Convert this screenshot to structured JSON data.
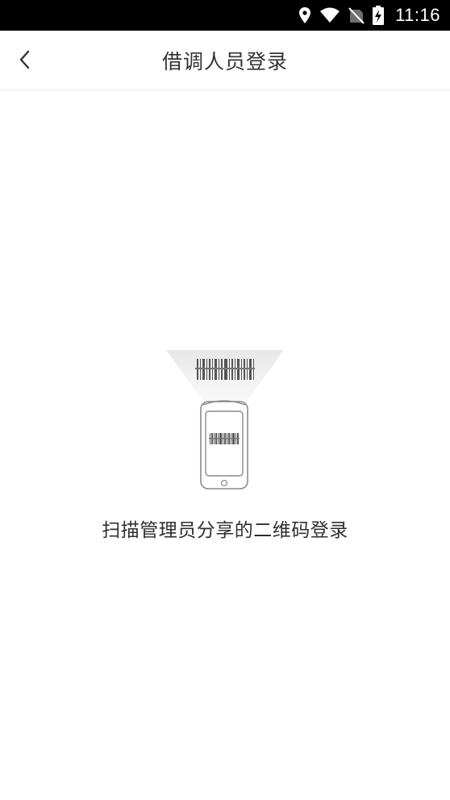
{
  "status_bar": {
    "time": "11:16",
    "icons": [
      "location-icon",
      "wifi-icon",
      "no-sim-icon",
      "battery-charging-icon"
    ]
  },
  "nav": {
    "title": "借调人员登录",
    "back_icon": "chevron-left-icon"
  },
  "main": {
    "illustration_icon": "phone-scan-barcode-illustration",
    "hint": "扫描管理员分享的二维码登录"
  },
  "colors": {
    "status_bar_bg": "#000000",
    "background": "#ffffff",
    "title_text": "#333333",
    "divider": "#e6e6e6"
  }
}
